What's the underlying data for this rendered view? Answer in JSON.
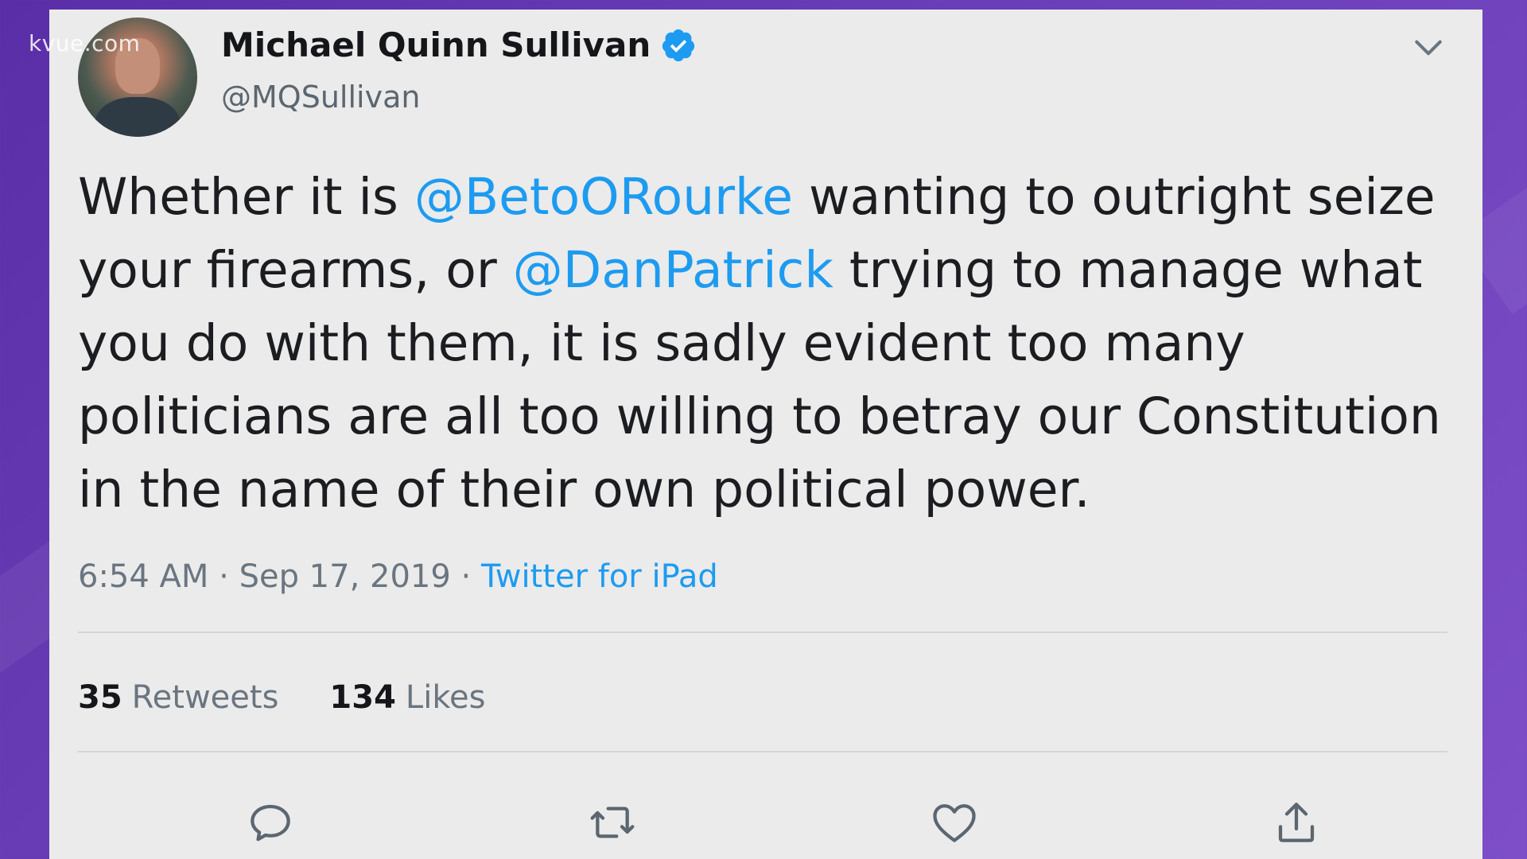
{
  "watermark": "kvue.com",
  "tweet": {
    "author_name": "Michael Quinn Sullivan",
    "handle": "@MQSullivan",
    "text": {
      "part1": "Whether it is ",
      "mention1": "@BetoORourke",
      "part2": " wanting to outright seize your firearms, or ",
      "mention2": "@DanPatrick",
      "part3": " trying to manage what you do with them, it is sadly evident too many politicians are all too willing to betray our Constitution in the name of their own political power."
    },
    "time": "6:54 AM",
    "separator": " · ",
    "date": "Sep 17, 2019",
    "source": "Twitter for iPad",
    "retweets_count": "35",
    "retweets_label": "Retweets",
    "likes_count": "134",
    "likes_label": "Likes"
  },
  "colors": {
    "accent": "#1d9bf0",
    "background": "#6b3fb8",
    "card": "#ebebeb"
  },
  "icons": {
    "verified": "verified-badge-icon",
    "caret": "chevron-down-icon",
    "reply": "reply-icon",
    "retweet": "retweet-icon",
    "like": "heart-icon",
    "share": "share-icon"
  }
}
